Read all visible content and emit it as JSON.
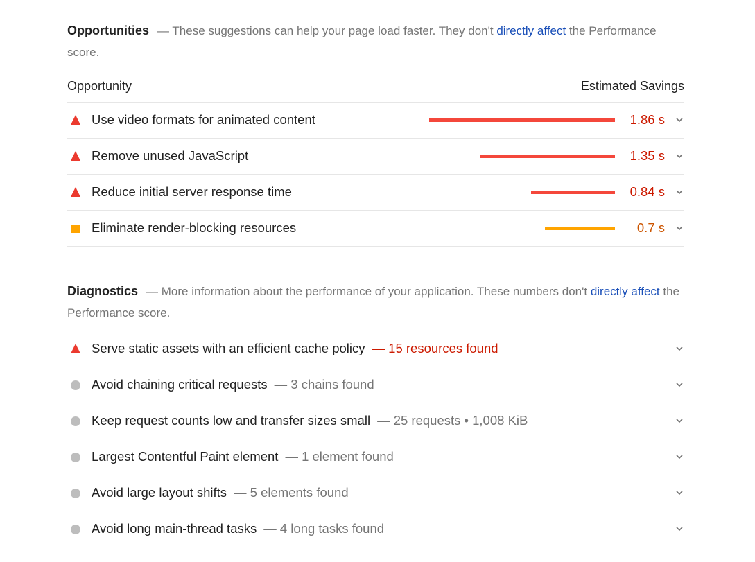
{
  "opportunities": {
    "title": "Opportunities",
    "desc_before": "— These suggestions can help your page load faster. They don't ",
    "desc_link": "directly affect",
    "desc_after": " the Performance score.",
    "col_left": "Opportunity",
    "col_right": "Estimated Savings",
    "items": [
      {
        "label": "Use video formats for animated content",
        "saving": "1.86 s",
        "severity": "fail",
        "savings_seconds": 1.86
      },
      {
        "label": "Remove unused JavaScript",
        "saving": "1.35 s",
        "severity": "fail",
        "savings_seconds": 1.35
      },
      {
        "label": "Reduce initial server response time",
        "saving": "0.84 s",
        "severity": "fail",
        "savings_seconds": 0.84
      },
      {
        "label": "Eliminate render-blocking resources",
        "saving": "0.7 s",
        "severity": "average",
        "savings_seconds": 0.7
      }
    ]
  },
  "diagnostics": {
    "title": "Diagnostics",
    "desc_before": "— More information about the performance of your application. These numbers don't ",
    "desc_link": "directly affect",
    "desc_after": " the Performance score.",
    "items": [
      {
        "label": "Serve static assets with an efficient cache policy",
        "display": "— 15 resources found",
        "severity": "fail"
      },
      {
        "label": "Avoid chaining critical requests",
        "display": "— 3 chains found",
        "severity": "info"
      },
      {
        "label": "Keep request counts low and transfer sizes small",
        "display": "— 25 requests • 1,008 KiB",
        "severity": "info"
      },
      {
        "label": "Largest Contentful Paint element",
        "display": "— 1 element found",
        "severity": "info"
      },
      {
        "label": "Avoid large layout shifts",
        "display": "— 5 elements found",
        "severity": "info"
      },
      {
        "label": "Avoid long main-thread tasks",
        "display": "— 4 long tasks found",
        "severity": "info"
      }
    ]
  },
  "colors": {
    "fail": "#eb3a2f",
    "average": "#ffa400",
    "info": "#bdbdbd",
    "link": "#1a4fb8"
  },
  "icons": {
    "fail": "warning-triangle-icon",
    "average": "average-square-icon",
    "info": "info-circle-icon",
    "expand": "chevron-down-icon"
  }
}
